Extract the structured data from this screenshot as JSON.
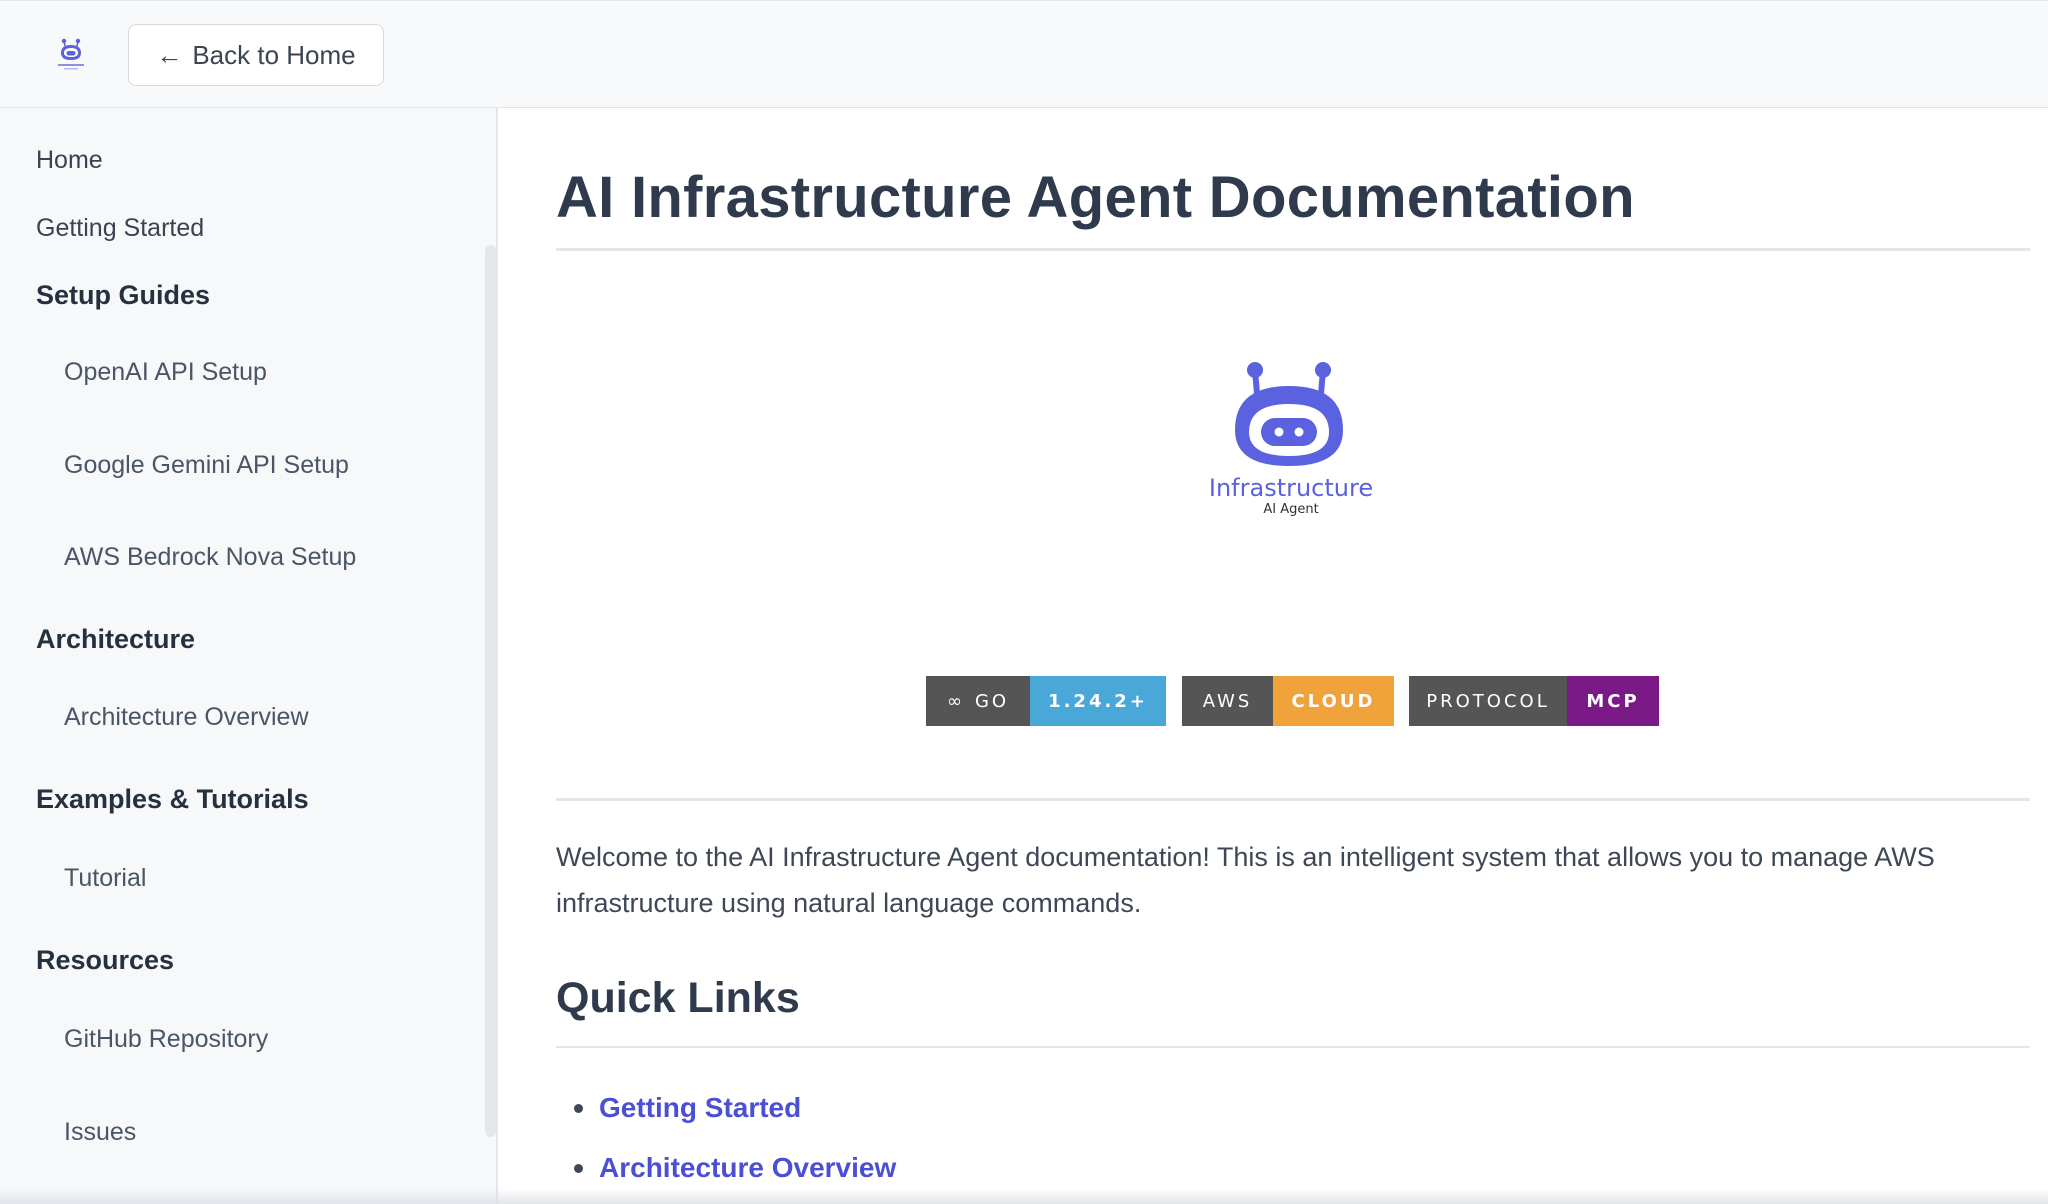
{
  "header": {
    "back_label": "Back to Home",
    "logo_icon": "robot-logo-icon"
  },
  "sidebar": {
    "home": "Home",
    "getting_started": "Getting Started",
    "setup_guides": {
      "title": "Setup Guides",
      "items": [
        "OpenAI API Setup",
        "Google Gemini API Setup",
        "AWS Bedrock Nova Setup"
      ]
    },
    "architecture": {
      "title": "Architecture",
      "items": [
        "Architecture Overview"
      ]
    },
    "examples": {
      "title": "Examples & Tutorials",
      "items": [
        "Tutorial"
      ]
    },
    "resources": {
      "title": "Resources",
      "items": [
        "GitHub Repository",
        "Issues"
      ]
    }
  },
  "main": {
    "title": "AI Infrastructure Agent Documentation",
    "logo": {
      "name": "Infrastructure",
      "subtitle": "AI Agent"
    },
    "badges": [
      {
        "label": "GO",
        "value": "1.24.2+",
        "color": "#4aa8d8"
      },
      {
        "label": "AWS",
        "value": "CLOUD",
        "color": "#f0a23b"
      },
      {
        "label": "PROTOCOL",
        "value": "MCP",
        "color": "#7b1a87"
      }
    ],
    "intro": "Welcome to the AI Infrastructure Agent documentation! This is an intelligent system that allows you to manage AWS infrastructure using natural language commands.",
    "quick_links": {
      "title": "Quick Links",
      "items": [
        "Getting Started",
        "Architecture Overview"
      ]
    }
  },
  "colors": {
    "accent": "#5a62e0",
    "link": "#4a4fd4"
  }
}
